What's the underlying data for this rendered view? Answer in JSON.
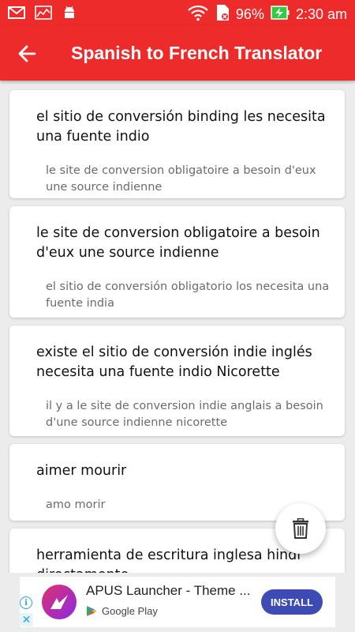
{
  "status_bar": {
    "battery": "96%",
    "time": "2:30 am"
  },
  "app_bar": {
    "title": "Spanish to French Translator"
  },
  "history": [
    {
      "source": "el sitio de conversión binding les necesita una fuente indio",
      "translation": "le site de conversion obligatoire a besoin d'eux une source indienne"
    },
    {
      "source": "le site de conversion obligatoire a besoin d'eux une source indienne",
      "translation": "el sitio de conversión obligatorio los necesita una fuente india"
    },
    {
      "source": "existe el sitio de conversión indie inglés necesita una fuente indio Nicorette",
      "translation": "il y a le site de conversion indie anglais a besoin d'une source indienne nicorette"
    },
    {
      "source": "aimer mourir",
      "translation": "amo morir"
    },
    {
      "source": "herramienta de escritura inglesa hindi directamente",
      "translation": ""
    }
  ],
  "ad": {
    "title": "APUS Launcher - Theme ...",
    "store": "Google Play",
    "install_label": "INSTALL"
  },
  "colors": {
    "primary": "#ee2b2b",
    "install_button": "#3f4bb5"
  }
}
